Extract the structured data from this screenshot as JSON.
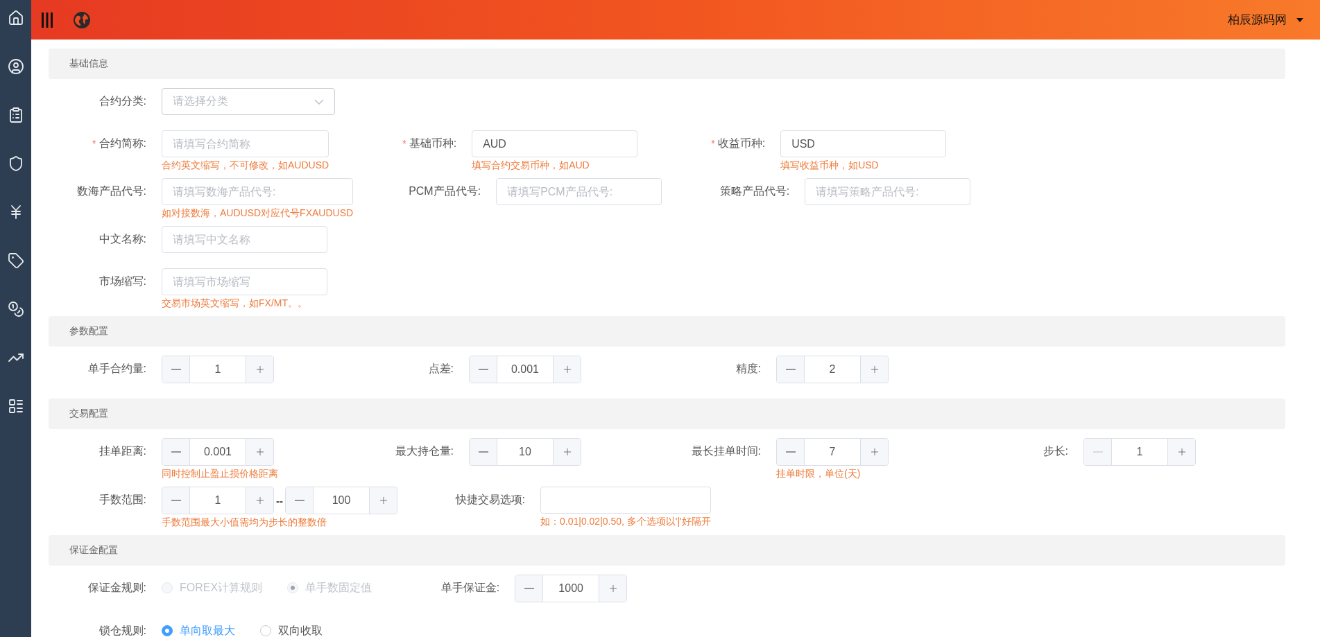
{
  "header": {
    "user": "柏辰源码网"
  },
  "sections": [
    {
      "title": "基础信息",
      "rows": [
        [
          {
            "kind": "select",
            "label": "合约分类:",
            "placeholder": "请选择分类"
          }
        ],
        [
          {
            "kind": "input",
            "mark": "*",
            "label": "合约简称:",
            "placeholder": "请填写合约简称",
            "hint": "合约英文缩写，不可修改，如AUDUSD"
          },
          {
            "kind": "input",
            "mark": "*",
            "label": "基础币种:",
            "value": "AUD",
            "hint": "填写合约交易币种，如AUD"
          },
          {
            "kind": "input",
            "mark": "*",
            "label": "收益币种:",
            "value": "USD",
            "hint": "填写收益币种，如USD"
          }
        ],
        [
          {
            "kind": "input",
            "label": "数海产品代号:",
            "placeholder": "请填写数海产品代号:",
            "hint": "如对接数海，AUDUSD对应代号FXAUDUSD"
          },
          {
            "kind": "input",
            "label": "PCM产品代号:",
            "placeholder": "请填写PCM产品代号:"
          },
          {
            "kind": "input",
            "label": "策略产品代号:",
            "placeholder": "请填写策略产品代号:"
          }
        ],
        [
          {
            "kind": "input",
            "label": "中文名称:",
            "placeholder": "请填写中文名称"
          }
        ],
        [
          {
            "kind": "input",
            "label": "市场缩写:",
            "placeholder": "请填写市场缩写",
            "hint": "交易市场英文缩写，如FX/MT。。"
          }
        ]
      ]
    },
    {
      "title": "参数配置",
      "rows": [
        [
          {
            "kind": "stepper",
            "label": "单手合约量:",
            "value": "1",
            "minus_disabled": false
          },
          {
            "kind": "stepper",
            "label": "点差:",
            "value": "0.001",
            "minus_disabled": false
          },
          {
            "kind": "stepper",
            "label": "精度:",
            "value": "2",
            "minus_disabled": false
          }
        ]
      ]
    },
    {
      "title": "交易配置",
      "rows": [
        [
          {
            "kind": "stepper",
            "label": "挂单距离:",
            "value": "0.001",
            "minus_disabled": false,
            "hint": "同时控制止盈止损价格距离"
          },
          {
            "kind": "stepper",
            "label": "最大持仓量:",
            "value": "10",
            "minus_disabled": false
          },
          {
            "kind": "stepper",
            "label": "最长挂单时间:",
            "value": "7",
            "minus_disabled": false,
            "hint": "挂单时限，单位(天)"
          },
          {
            "kind": "stepper",
            "label": "步长:",
            "value": "1",
            "minus_disabled": true
          }
        ],
        [
          {
            "kind": "range",
            "label": "手数范围:",
            "from": "1",
            "separator": "--",
            "to": "100",
            "hint": "手数范围最大小值需均为步长的整数倍"
          },
          {
            "kind": "input",
            "label": "快捷交易选项:",
            "hint": "如：0.01|0.02|0.50, 多个选项以'|'好隔开"
          }
        ]
      ]
    },
    {
      "title": "保证金配置",
      "rows": [
        [
          {
            "kind": "radio",
            "label": "保证金规则:",
            "options": [
              {
                "label": "FOREX计算规则",
                "selected": false,
                "disabled": true
              },
              {
                "label": "单手数固定值",
                "selected": true,
                "disabled": true
              }
            ]
          },
          {
            "kind": "stepper",
            "label": "单手保证金:",
            "value": "1000",
            "minus_disabled": false
          }
        ],
        [
          {
            "kind": "radio",
            "label": "锁仓规则:",
            "options": [
              {
                "label": "单向取最大",
                "selected": true,
                "disabled": false
              },
              {
                "label": "双向收取",
                "selected": false,
                "disabled": false
              }
            ]
          }
        ]
      ]
    }
  ]
}
